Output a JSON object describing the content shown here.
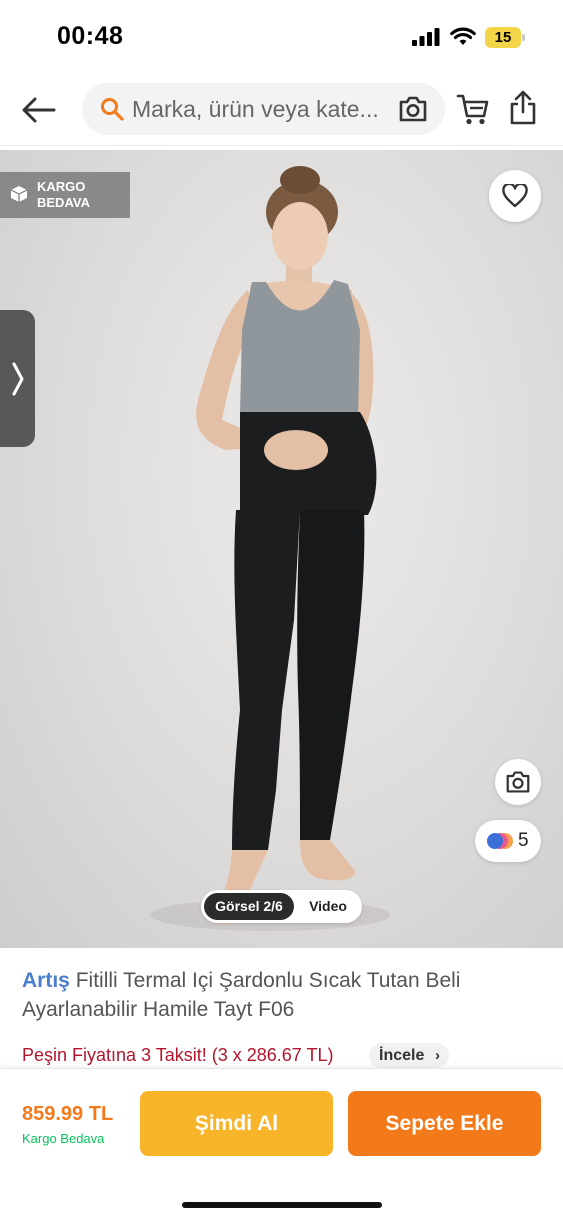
{
  "status_bar": {
    "time": "00:48",
    "battery_level": "15"
  },
  "nav": {
    "search_placeholder": "Marka, ürün veya kate...",
    "icons": [
      "back-arrow-icon",
      "search-icon",
      "camera-icon",
      "cart-icon",
      "share-icon"
    ]
  },
  "gallery": {
    "cargo_badge_line1": "KARGO",
    "cargo_badge_line2": "BEDAVA",
    "color_variant_count": "5",
    "media_tab_active": "Görsel 2/6",
    "media_tab_video": "Video",
    "icons": [
      "heart-icon",
      "chevron-right-icon",
      "camera-icon"
    ]
  },
  "product": {
    "brand": "Artış",
    "name": "Fitilli Termal Içi Şardonlu Sıcak Tutan Beli Ayarlanabilir Hamile Tayt F06",
    "installment_text": "Peşin Fiyatına 3 Taksit! (3 x 286.67 TL)",
    "review_label": "İncele"
  },
  "bottom_bar": {
    "price": "859.99 TL",
    "shipping": "Kargo Bedava",
    "buy_now_label": "Şimdi Al",
    "add_to_cart_label": "Sepete Ekle"
  },
  "colors": {
    "brand_orange": "#f27a1a",
    "buy_yellow": "#f9b52a",
    "installment_red": "#b3152c",
    "shipping_green": "#0bc15c",
    "brand_blue": "#4a7fd0"
  }
}
